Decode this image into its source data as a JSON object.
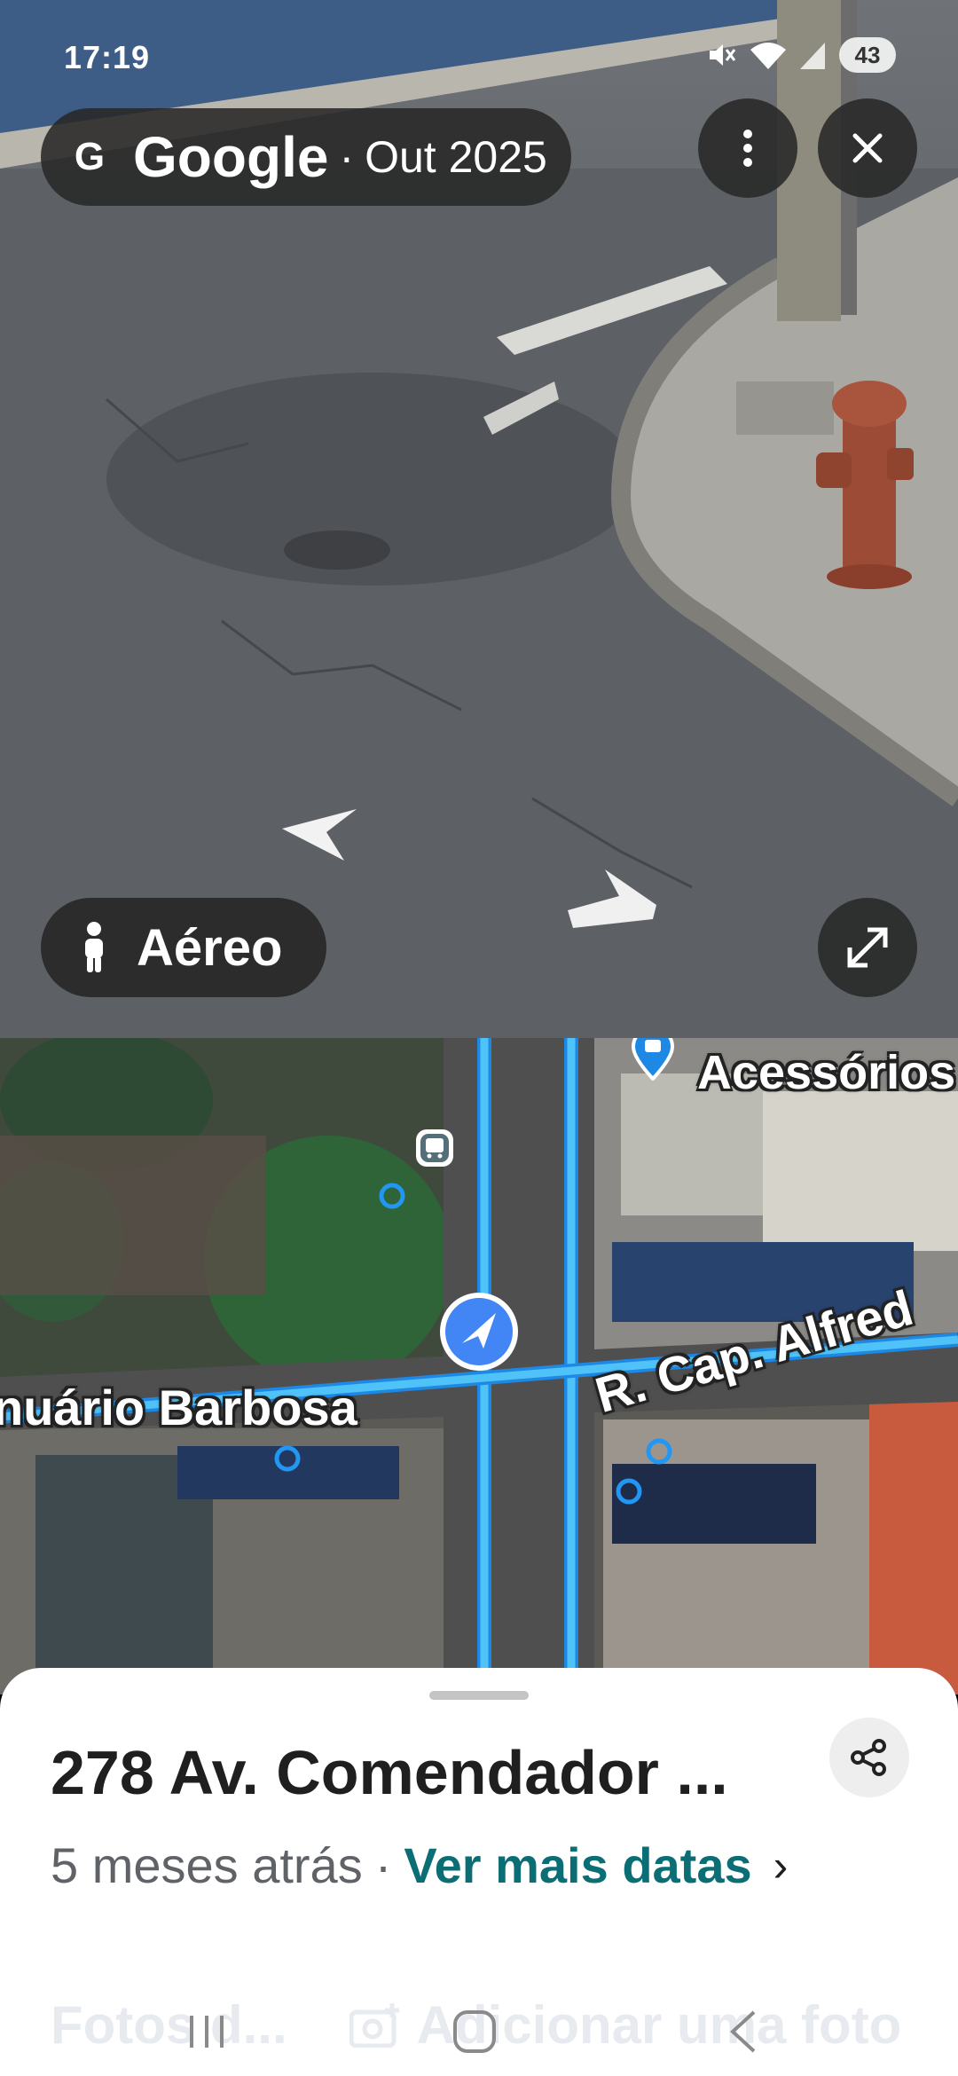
{
  "status_bar": {
    "time": "17:19",
    "battery": "43",
    "icons": [
      "mute-icon",
      "wifi-icon",
      "signal-icon",
      "battery-icon"
    ]
  },
  "street_view": {
    "source_logo": "G",
    "source_name": "Google",
    "separator": "·",
    "capture_date": "Out 2025",
    "more_icon": "more-vertical-icon",
    "close_icon": "close-icon",
    "mode_button_label": "Aéreo",
    "mode_button_icon": "pegman-icon",
    "expand_icon": "expand-icon",
    "nav_arrows": [
      "arrow-left-icon",
      "arrow-right-icon"
    ]
  },
  "map": {
    "labels": {
      "business": "Acessórios",
      "street_left": "nuário Barbosa",
      "street_right": "R. Cap. Alfred"
    },
    "route_color": "#29b6f6",
    "location_marker_color": "#4285f4",
    "icons": [
      "bus-stop-icon",
      "place-pin-icon",
      "location-arrow-icon"
    ]
  },
  "sheet": {
    "title": "278 Av. Comendador ...",
    "time_ago": "5 meses atrás",
    "separator": "·",
    "more_dates_link": "Ver mais datas",
    "chevron": "›",
    "share_icon": "share-icon",
    "faded_photos_label": "Fotos d...",
    "faded_add_photo_label": "Adicionar uma foto",
    "link_color": "#0b6e75"
  },
  "nav_bar": {
    "icons": [
      "recents-icon",
      "home-icon",
      "back-icon"
    ]
  }
}
